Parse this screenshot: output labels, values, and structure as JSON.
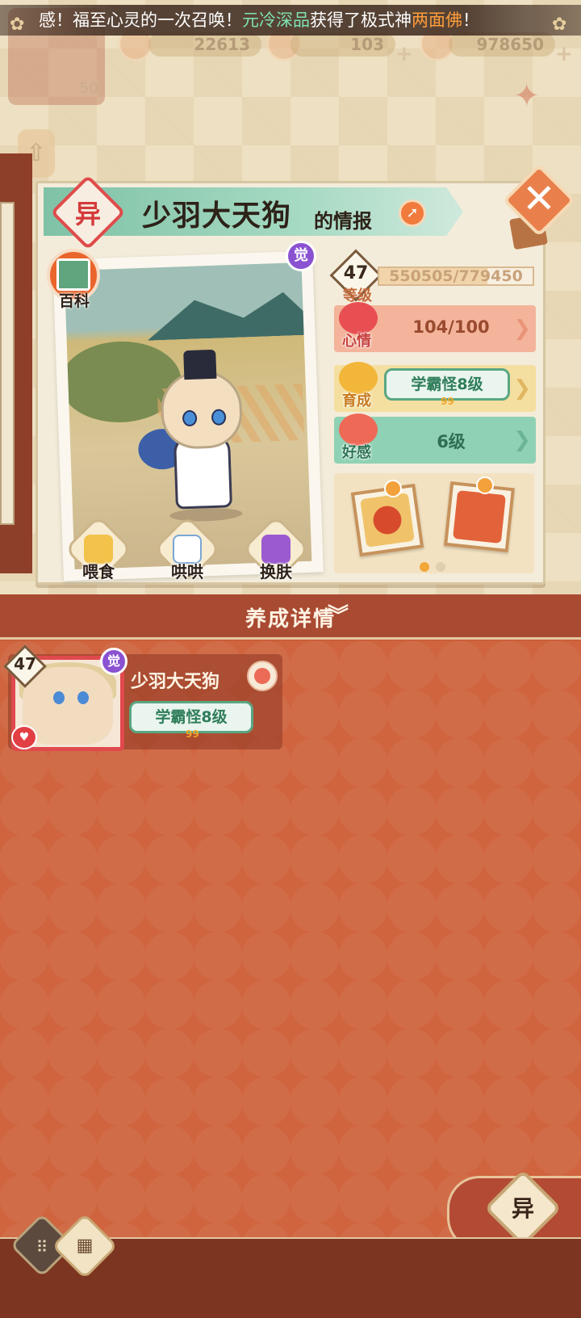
{
  "broadcast": {
    "prefix": "感！福至心灵的一次召唤！",
    "player": "元冷深品",
    "middle": "获得了极式神",
    "shikigami": "两面佛",
    "suffix": "！"
  },
  "resources": {
    "jade_left": "22613",
    "stamina": "103",
    "coins": "978650",
    "player_level": "50"
  },
  "panel": {
    "badge": "异",
    "name": "少羽大天狗",
    "name_suffix": "的情报",
    "awaken_mark": "觉"
  },
  "portrait_actions": [
    {
      "label": "百科",
      "icon": "encyclopedia-icon"
    },
    {
      "label": "喂食",
      "icon": "noodle-bowl-icon"
    },
    {
      "label": "哄哄",
      "icon": "milk-carton-icon"
    },
    {
      "label": "换肤",
      "icon": "kimono-icon"
    }
  ],
  "stats": {
    "level": "47",
    "level_label": "等级",
    "exp_text": "550505/779450",
    "exp_progress": 0.706,
    "mood_label": "心情",
    "mood_value": "104/100",
    "growth_label": "育成",
    "growth_tag": "学霸怪8级",
    "growth_dots": "99",
    "affection_label": "好感",
    "affection_value": "6级"
  },
  "gallery": {
    "items": [
      "hotpot-photo",
      "daruma-photo"
    ],
    "page_count": 2,
    "active_page": 0
  },
  "section": {
    "title": "养成详情",
    "expand_icon": "double-chevron-down-icon"
  },
  "card": {
    "level": "47",
    "awaken_mark": "觉",
    "name": "少羽大天狗",
    "tag": "学霸怪8级",
    "tag_dots": "99"
  },
  "bottom": {
    "yi_tab": "异"
  },
  "colors": {
    "accent_green": "#5aa683",
    "accent_red": "#e0494e",
    "bg_lower": "#cf643f",
    "highlight_green": "#7fe3b3",
    "highlight_orange": "#ff9d3a"
  }
}
